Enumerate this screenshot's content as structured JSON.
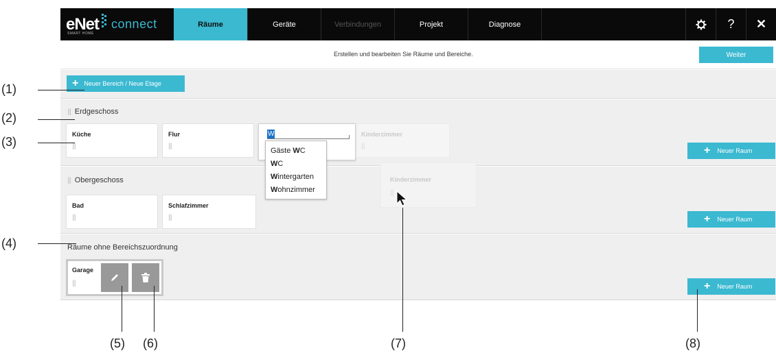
{
  "app": {
    "logo_brand": "eNet",
    "logo_sub": "SMART HOME",
    "logo_product": "connect"
  },
  "tabs": [
    {
      "label": "Räume",
      "state": "active"
    },
    {
      "label": "Geräte",
      "state": "normal"
    },
    {
      "label": "Verbindungen",
      "state": "disabled"
    },
    {
      "label": "Projekt",
      "state": "normal"
    },
    {
      "label": "Diagnose",
      "state": "normal"
    }
  ],
  "topbar_icons": {
    "settings": "gear-icon",
    "help": "?",
    "help_icon": "help-icon",
    "close": "✕",
    "close_icon": "close-icon"
  },
  "info_text": "Erstellen und bearbeiten Sie Räume und Bereiche.",
  "weiter_label": "Weiter",
  "new_area_label": "Neuer Bereich / Neue Etage",
  "new_room_label": "Neuer Raum",
  "areas": [
    {
      "title": "Erdgeschoss",
      "rooms": [
        "Küche",
        "Flur"
      ],
      "ghost_room": "Kinderzimmer"
    },
    {
      "title": "Obergeschoss",
      "rooms": [
        "Bad",
        "Schlafzimmer"
      ]
    },
    {
      "title": "Räume ohne Bereichszuordnung",
      "rooms": [
        "Garage"
      ]
    }
  ],
  "edit_room": {
    "input_value": "W",
    "suggestions": [
      {
        "pre": "Gäste ",
        "match": "W",
        "post": "C"
      },
      {
        "pre": "",
        "match": "W",
        "post": "C"
      },
      {
        "pre": "",
        "match": "W",
        "post": "intergarten"
      },
      {
        "pre": "",
        "match": "W",
        "post": "ohnzimmer"
      }
    ]
  },
  "dragged_room": "Kinderzimmer",
  "garage_buttons": {
    "edit_icon": "pencil-icon",
    "delete_icon": "trash-icon"
  },
  "annotations": [
    "(1)",
    "(2)",
    "(3)",
    "(4)",
    "(5)",
    "(6)",
    "(7)",
    "(8)"
  ],
  "colors": {
    "accent": "#3bb9d1",
    "topbar": "#0a0a0a",
    "panel": "#efefef",
    "selection": "#1c73c9"
  }
}
